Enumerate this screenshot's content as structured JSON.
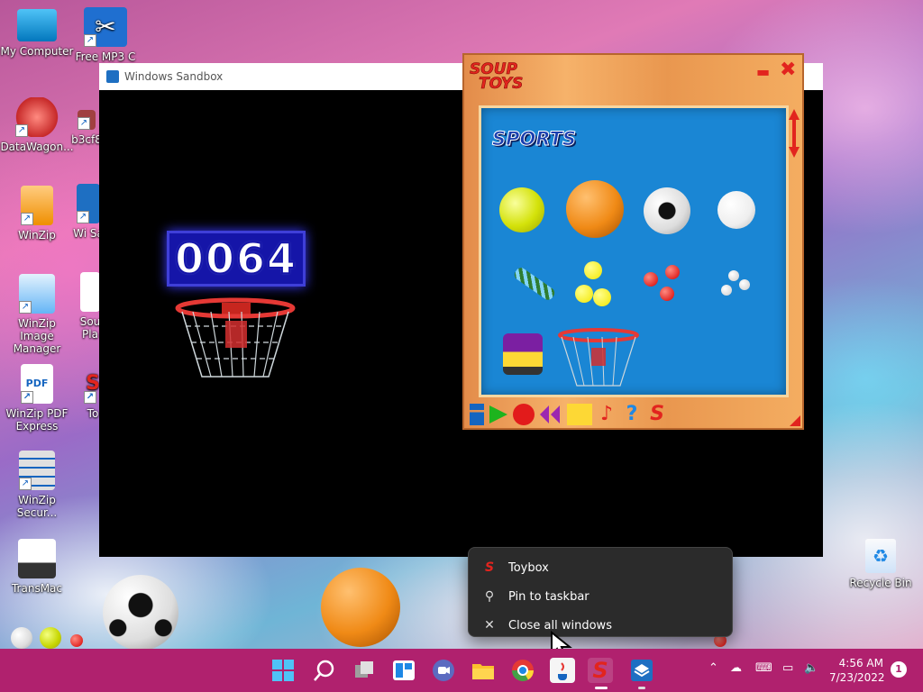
{
  "desktop": {
    "icons": [
      {
        "label": "My Computer"
      },
      {
        "label": "Free MP3 C"
      },
      {
        "label": "DataWagon..."
      },
      {
        "label": "b3cf8"
      },
      {
        "label": "WinZip"
      },
      {
        "label": "Wi Sa"
      },
      {
        "label": "WinZip Image Manager"
      },
      {
        "label": "Sou Pla"
      },
      {
        "label": "WinZip PDF Express"
      },
      {
        "label": "To"
      },
      {
        "label": "WinZip Secur..."
      },
      {
        "label": "TransMac"
      },
      {
        "label": "Recycle Bin"
      }
    ]
  },
  "sandbox": {
    "title": "Windows Sandbox",
    "score": "0064"
  },
  "toys": {
    "logo_line1": "SOUP",
    "logo_line2": "TOYS",
    "minimize": "▬",
    "close": "✖",
    "category": "SPORTS",
    "items": [
      "tennis-ball",
      "basketball",
      "soccer-ball",
      "baseball",
      "rope",
      "yellow-balls",
      "red-balls",
      "white-balls",
      "roller-skates",
      "basketball-hoop"
    ]
  },
  "jumplist": {
    "items": [
      {
        "label": "Toybox",
        "icon": "soup-toys-icon"
      },
      {
        "label": "Pin to taskbar",
        "icon": "pin-icon"
      },
      {
        "label": "Close all windows",
        "icon": "close-icon"
      }
    ]
  },
  "taskbar": {
    "time": "4:56 AM",
    "date": "7/23/2022",
    "notification_count": "1",
    "colors": {
      "background": "#b0216e"
    }
  }
}
